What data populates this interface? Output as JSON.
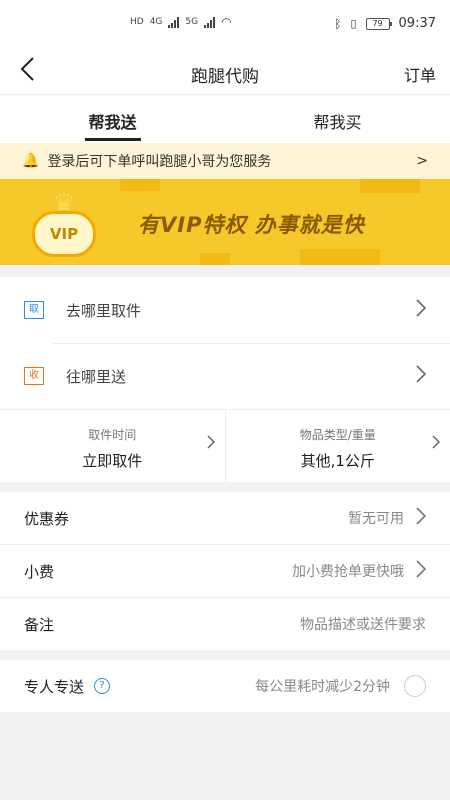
{
  "status_bar": {
    "network_left": "HD",
    "network_4g": "4G",
    "network_5g": "5G",
    "battery": "79",
    "time": "09:37"
  },
  "nav": {
    "back_icon": "chevron-left-icon",
    "title": "跑腿代购",
    "right_action": "订单"
  },
  "tabs": [
    {
      "label": "帮我送",
      "active": true
    },
    {
      "label": "帮我买",
      "active": false
    }
  ],
  "notice": {
    "text": "登录后可下单呼叫跑腿小哥为您服务",
    "arrow": ">"
  },
  "banner": {
    "badge": "VIP",
    "text": "有VIP特权  办事就是快",
    "color": "#f7c51e"
  },
  "address": {
    "pickup": {
      "tag": "取",
      "text": "去哪里取件"
    },
    "deliver": {
      "tag": "收",
      "text": "往哪里送"
    }
  },
  "details": {
    "pickup_time": {
      "label": "取件时间",
      "value": "立即取件"
    },
    "item_type": {
      "label": "物品类型/重量",
      "value": "其他,1公斤"
    }
  },
  "options": {
    "coupon": {
      "label": "优惠券",
      "value": "暂无可用"
    },
    "tip": {
      "label": "小费",
      "value": "加小费抢单更快哦"
    },
    "remark": {
      "label": "备注",
      "placeholder": "物品描述或送件要求"
    }
  },
  "express": {
    "label": "专人专送",
    "help_icon": "?",
    "desc": "每公里耗时减少2分钟"
  }
}
